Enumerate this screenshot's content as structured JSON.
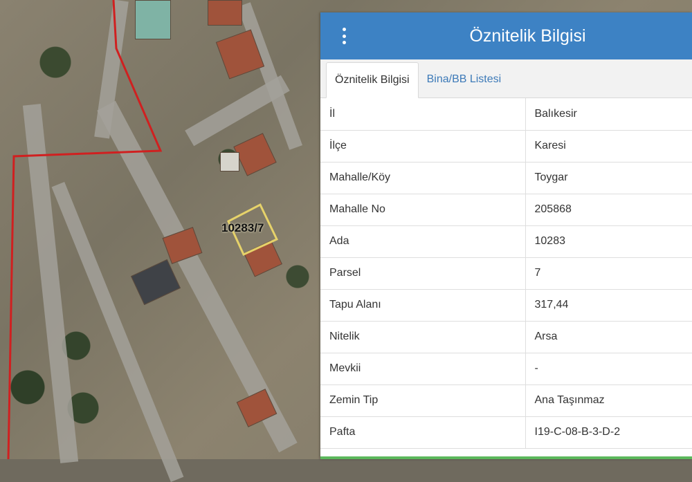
{
  "map": {
    "parcel_label": "10283/7"
  },
  "panel": {
    "title": "Öznitelik Bilgisi",
    "menu_icon": "vertical-ellipsis-icon",
    "header_color": "#3d82c4",
    "tabs": [
      {
        "label": "Öznitelik Bilgisi",
        "active": true
      },
      {
        "label": "Bina/BB Listesi",
        "active": false
      }
    ],
    "rows": [
      {
        "key": "İl",
        "value": "Balıkesir"
      },
      {
        "key": "İlçe",
        "value": "Karesi"
      },
      {
        "key": "Mahalle/Köy",
        "value": "Toygar"
      },
      {
        "key": "Mahalle No",
        "value": "205868"
      },
      {
        "key": "Ada",
        "value": "10283"
      },
      {
        "key": "Parsel",
        "value": "7"
      },
      {
        "key": "Tapu Alanı",
        "value": "317,44"
      },
      {
        "key": "Nitelik",
        "value": "Arsa"
      },
      {
        "key": "Mevkii",
        "value": "-"
      },
      {
        "key": "Zemin Tip",
        "value": "Ana Taşınmaz"
      },
      {
        "key": "Pafta",
        "value": "I19-C-08-B-3-D-2"
      }
    ]
  }
}
